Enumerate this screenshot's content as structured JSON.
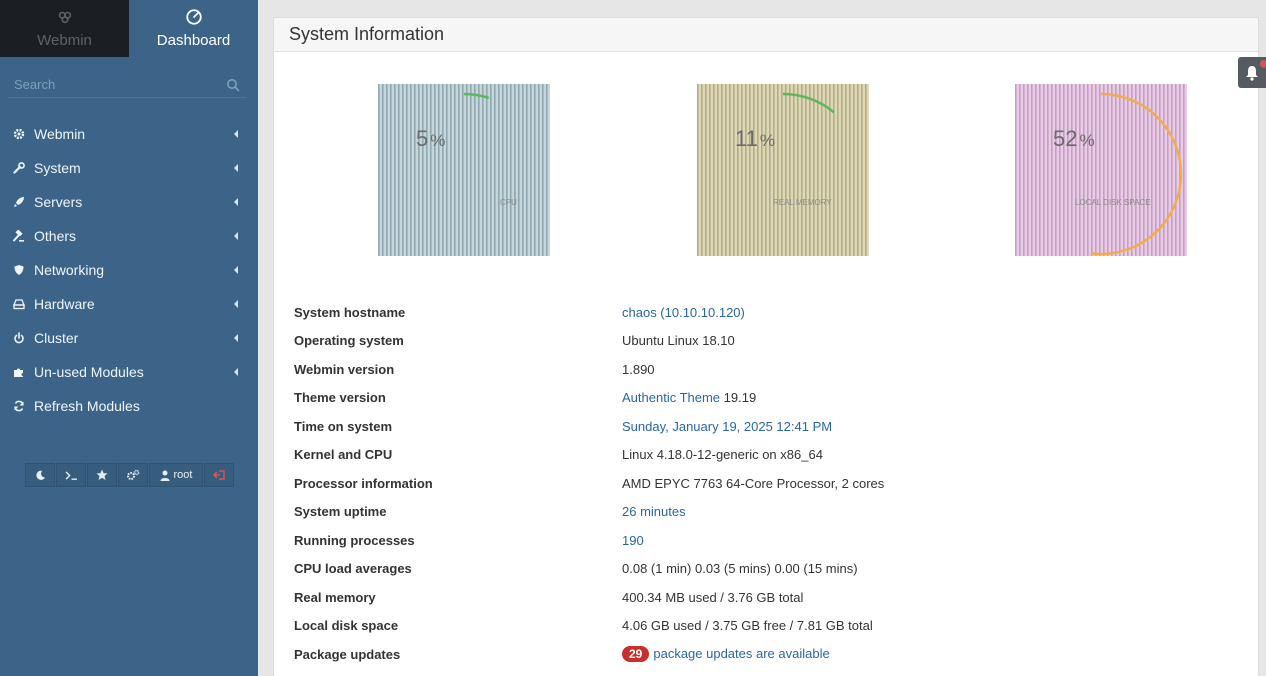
{
  "sidebar": {
    "switch": {
      "webmin_label": "Webmin",
      "dashboard_label": "Dashboard"
    },
    "search": {
      "placeholder": "Search"
    },
    "items": [
      {
        "label": "Webmin",
        "icon": "gear-icon"
      },
      {
        "label": "System",
        "icon": "wrench-icon"
      },
      {
        "label": "Servers",
        "icon": "rocket-icon"
      },
      {
        "label": "Others",
        "icon": "gavel-icon"
      },
      {
        "label": "Networking",
        "icon": "shield-icon"
      },
      {
        "label": "Hardware",
        "icon": "hdd-icon"
      },
      {
        "label": "Cluster",
        "icon": "power-icon"
      },
      {
        "label": "Un-used Modules",
        "icon": "puzzle-icon"
      },
      {
        "label": "Refresh Modules",
        "icon": "refresh-icon"
      }
    ],
    "toolbar": {
      "user_label": "root"
    }
  },
  "main": {
    "title": "System Information",
    "gauges": [
      {
        "value": "5",
        "unit": "%",
        "label": "CPU",
        "percent": 5,
        "color": "#5cb85c"
      },
      {
        "value": "11",
        "unit": "%",
        "label": "REAL MEMORY",
        "percent": 11,
        "color": "#5cb85c"
      },
      {
        "value": "52",
        "unit": "%",
        "label": "LOCAL DISK SPACE",
        "percent": 52,
        "color": "#f0ad4e"
      }
    ],
    "info": {
      "hostname_label": "System hostname",
      "hostname_value": "chaos (10.10.10.120)",
      "os_label": "Operating system",
      "os_value": "Ubuntu Linux 18.10",
      "webmin_label": "Webmin version",
      "webmin_value": "1.890",
      "theme_label": "Theme version",
      "theme_link": "Authentic Theme",
      "theme_version": "19.19",
      "time_label": "Time on system",
      "time_value": "Sunday, January 19, 2025 12:41 PM",
      "kernel_label": "Kernel and CPU",
      "kernel_value": "Linux 4.18.0-12-generic on x86_64",
      "proc_label": "Processor information",
      "proc_value": "AMD EPYC 7763 64-Core Processor, 2 cores",
      "uptime_label": "System uptime",
      "uptime_value": "26 minutes",
      "processes_label": "Running processes",
      "processes_value": "190",
      "load_label": "CPU load averages",
      "load_value": "0.08 (1 min) 0.03 (5 mins) 0.00 (15 mins)",
      "mem_label": "Real memory",
      "mem_value": "400.34 MB used / 3.76 GB total",
      "disk_label": "Local disk space",
      "disk_value": "4.06 GB used / 3.75 GB free / 7.81 GB total",
      "pkg_label": "Package updates",
      "pkg_count": "29",
      "pkg_text": "package updates are available"
    }
  },
  "colors": {
    "sidebar": "#3b6488",
    "link": "#2a66a6",
    "badge": "#c9302c"
  }
}
